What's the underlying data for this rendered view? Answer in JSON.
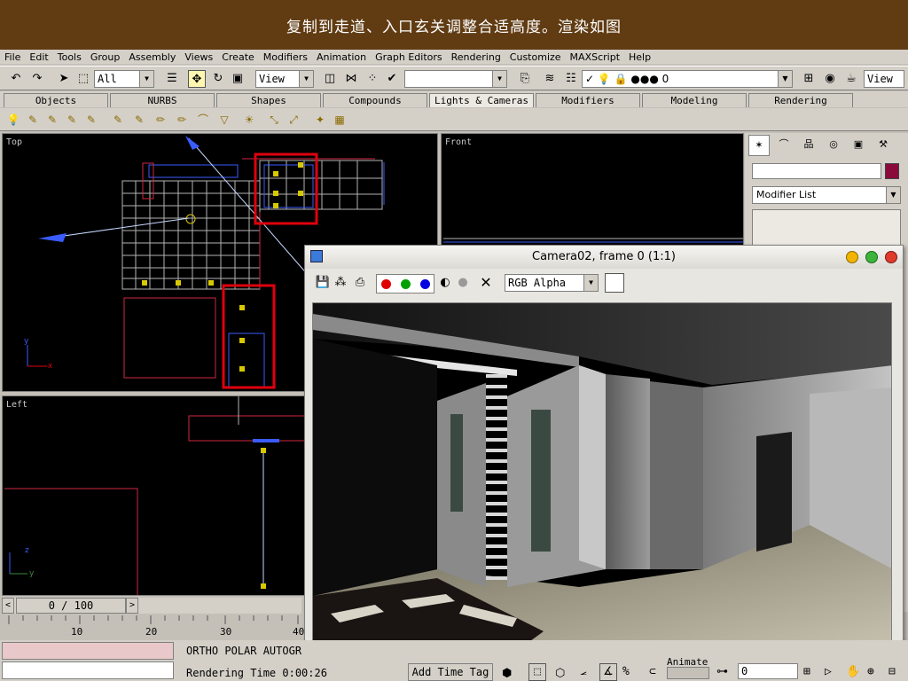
{
  "banner": {
    "text": "复制到走道、入口玄关调整合适高度。渲染如图"
  },
  "menu": [
    "File",
    "Edit",
    "Tools",
    "Group",
    "Assembly",
    "Views",
    "Create",
    "Modifiers",
    "Animation",
    "Graph Editors",
    "Rendering",
    "Customize",
    "MAXScript",
    "Help"
  ],
  "toolbar": {
    "selection_filter": "All",
    "reference_coord": "View",
    "named_selection": "",
    "layer_value": "0",
    "view_right": "View"
  },
  "tabs": [
    "Objects",
    "NURBS",
    "Shapes",
    "Compounds",
    "Lights & Cameras",
    "Modifiers",
    "Modeling",
    "Rendering"
  ],
  "selected_tab": "Lights & Cameras",
  "viewports": {
    "top_label": "Top",
    "front_label": "Front",
    "left_label": "Left",
    "axis_x": "x",
    "axis_y": "y",
    "axis_z": "z"
  },
  "command_panel": {
    "object_name": "",
    "modifier_list": "Modifier List",
    "name_color": "#8b0a3c"
  },
  "render_window": {
    "title": "Camera02, frame 0 (1:1)",
    "channel": "RGB Alpha"
  },
  "timeline": {
    "frame_label": "0 / 100",
    "ticks": [
      "10",
      "20",
      "30",
      "40"
    ]
  },
  "status": {
    "snap_modes": "ORTHO  POLAR  AUTOGR",
    "rendering_time": "Rendering Time  0:00:26",
    "add_time_tag": "Add Time Tag",
    "animate_label": "Animate",
    "frame_field": "0",
    "view_field": "View"
  },
  "colors": {
    "banner": "#613c13",
    "highlight_box": "#e0000e"
  }
}
